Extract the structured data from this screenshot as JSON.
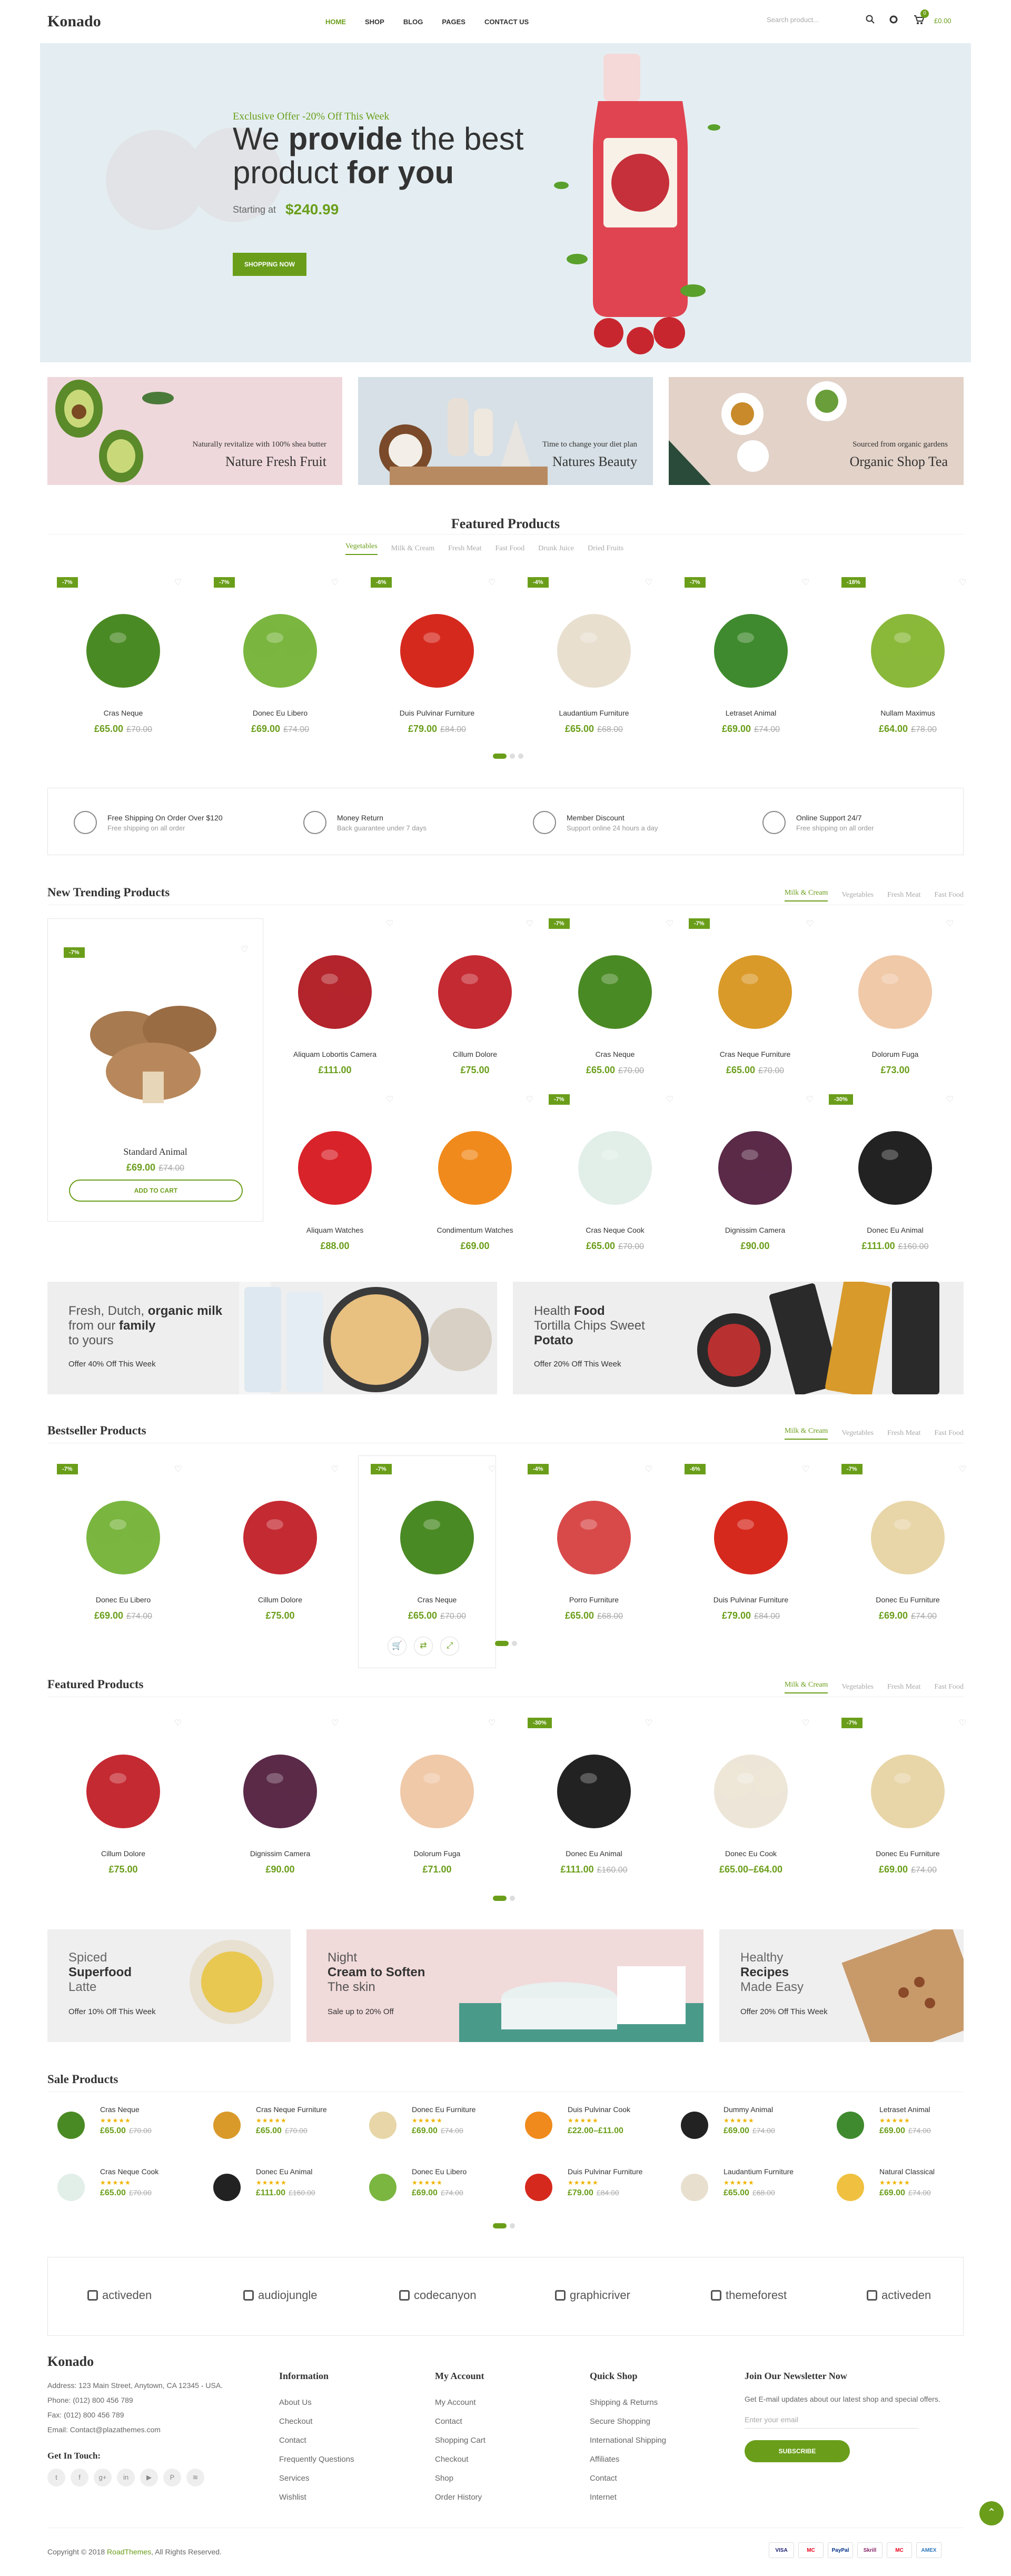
{
  "brand": {
    "logo": "Konado"
  },
  "nav": {
    "home": "HOME",
    "shop": "SHOP",
    "blog": "BLOG",
    "pages": "PAGES",
    "contact": "CONTACT US"
  },
  "header": {
    "search_placeholder": "Search product...",
    "cart_count": "0",
    "cart_total": "£0.00"
  },
  "hero": {
    "eyebrow": "Exclusive Offer -20% Off This Week",
    "line1a": "We ",
    "line1b": "provide",
    "line1c": " the best",
    "line2a": "product ",
    "line2b": "for you",
    "starting": "Starting at",
    "price": "$240.99",
    "button": "SHOPPING NOW"
  },
  "banners": [
    {
      "sub": "Naturally revitalize with 100% shea butter",
      "title": "Nature Fresh Fruit"
    },
    {
      "sub": "Time to change your diet plan",
      "title": "Natures Beauty"
    },
    {
      "sub": "Sourced from organic gardens",
      "title": "Organic Shop Tea"
    }
  ],
  "featured1": {
    "title": "Featured Products",
    "tabs": [
      "Vegetables",
      "Milk & Cream",
      "Fresh Meat",
      "Fast Food",
      "Drunk Juice",
      "Dried Fruits"
    ],
    "items": [
      {
        "badge": "-7%",
        "name": "Cras Neque",
        "price": "£65.00",
        "old": "£70.00",
        "color": "#4a8a24"
      },
      {
        "badge": "-7%",
        "name": "Donec Eu Libero",
        "price": "£69.00",
        "old": "£74.00",
        "color": "#7ab640"
      },
      {
        "badge": "-6%",
        "name": "Duis Pulvinar Furniture",
        "price": "£79.00",
        "old": "£84.00",
        "color": "#d6291e"
      },
      {
        "badge": "-4%",
        "name": "Laudantium Furniture",
        "price": "£65.00",
        "old": "£68.00",
        "color": "#e8dfcf"
      },
      {
        "badge": "-7%",
        "name": "Letraset Animal",
        "price": "£69.00",
        "old": "£74.00",
        "color": "#3f8a2e"
      },
      {
        "badge": "-18%",
        "name": "Nullam Maximus",
        "price": "£64.00",
        "old": "£78.00",
        "color": "#8ab83a"
      }
    ]
  },
  "services": [
    {
      "title": "Free Shipping On Order Over $120",
      "sub": "Free shipping on all order"
    },
    {
      "title": "Money Return",
      "sub": "Back guarantee under 7 days"
    },
    {
      "title": "Member Discount",
      "sub": "Support online 24 hours a day"
    },
    {
      "title": "Online Support 24/7",
      "sub": "Free shipping on all order"
    }
  ],
  "trending": {
    "title": "New Trending Products",
    "tabs": [
      "Milk & Cream",
      "Vegetables",
      "Fresh Meat",
      "Fast Food"
    ],
    "big": {
      "badge": "-7%",
      "name": "Standard Animal",
      "price": "£69.00",
      "old": "£74.00",
      "button": "ADD TO CART"
    },
    "items": [
      {
        "badge": "",
        "name": "Aliquam Lobortis Camera",
        "price": "£111.00",
        "old": "",
        "color": "#b3242c"
      },
      {
        "badge": "",
        "name": "Cillum Dolore",
        "price": "£75.00",
        "old": "",
        "color": "#c42a32"
      },
      {
        "badge": "-7%",
        "name": "Cras Neque",
        "price": "£65.00",
        "old": "£70.00",
        "color": "#4a8a24"
      },
      {
        "badge": "-7%",
        "name": "Cras Neque Furniture",
        "price": "£65.00",
        "old": "£70.00",
        "color": "#d99a2a"
      },
      {
        "badge": "",
        "name": "Dolorum Fuga",
        "price": "£73.00",
        "old": "",
        "color": "#f0c9a8"
      },
      {
        "badge": "",
        "name": "Aliquam Watches",
        "price": "£88.00",
        "old": "",
        "color": "#d8232a"
      },
      {
        "badge": "",
        "name": "Condimentum Watches",
        "price": "£69.00",
        "old": "",
        "color": "#f08a1c"
      },
      {
        "badge": "-7%",
        "name": "Cras Neque Cook",
        "price": "£65.00",
        "old": "£70.00",
        "color": "#e2eee8"
      },
      {
        "badge": "",
        "name": "Dignissim Camera",
        "price": "£90.00",
        "old": "",
        "color": "#5a2a48"
      },
      {
        "badge": "-30%",
        "name": "Donec Eu Animal",
        "price": "£111.00",
        "old": "£160.00",
        "color": "#222"
      }
    ]
  },
  "promos": [
    {
      "l1": "Fresh, Dutch, ",
      "l1b": "organic milk",
      "l2": "from our ",
      "l2b": "family",
      "l3": "to yours",
      "offer": "Offer 40% Off This Week"
    },
    {
      "l1": "Health ",
      "l1b": "Food",
      "l2": "Tortilla Chips Sweet",
      "l2b": "",
      "l3": "Potato",
      "offer": "Offer 20% Off This Week"
    }
  ],
  "bestseller": {
    "title": "Bestseller Products",
    "tabs": [
      "Milk & Cream",
      "Vegetables",
      "Fresh Meat",
      "Fast Food"
    ],
    "items": [
      {
        "badge": "-7%",
        "name": "Donec Eu Libero",
        "price": "£69.00",
        "old": "£74.00",
        "color": "#7ab640"
      },
      {
        "badge": "",
        "name": "Cillum Dolore",
        "price": "£75.00",
        "old": "",
        "color": "#c42a32"
      },
      {
        "badge": "-7%",
        "name": "Cras Neque",
        "price": "£65.00",
        "old": "£70.00",
        "color": "#4a8a24"
      },
      {
        "badge": "-4%",
        "name": "Porro Furniture",
        "price": "£65.00",
        "old": "£68.00",
        "color": "#d84a4a"
      },
      {
        "badge": "-6%",
        "name": "Duis Pulvinar Furniture",
        "price": "£79.00",
        "old": "£84.00",
        "color": "#d6291e"
      },
      {
        "badge": "-7%",
        "name": "Donec Eu Furniture",
        "price": "£69.00",
        "old": "£74.00",
        "color": "#e8d6a8"
      }
    ]
  },
  "featured2": {
    "title": "Featured Products",
    "tabs": [
      "Milk & Cream",
      "Vegetables",
      "Fresh Meat",
      "Fast Food"
    ],
    "items": [
      {
        "badge": "",
        "name": "Cillum Dolore",
        "price": "£75.00",
        "old": "",
        "color": "#c42a32"
      },
      {
        "badge": "",
        "name": "Dignissim Camera",
        "price": "£90.00",
        "old": "",
        "color": "#5a2a48"
      },
      {
        "badge": "",
        "name": "Dolorum Fuga",
        "price": "£71.00",
        "old": "",
        "color": "#f0c9a8"
      },
      {
        "badge": "-30%",
        "name": "Donec Eu Animal",
        "price": "£111.00",
        "old": "£160.00",
        "color": "#222"
      },
      {
        "badge": "",
        "name": "Donec Eu Cook",
        "price": "£65.00–£64.00",
        "old": "",
        "color": "#ede6d8"
      },
      {
        "badge": "-7%",
        "name": "Donec Eu Furniture",
        "price": "£69.00",
        "old": "£74.00",
        "color": "#e8d6a8"
      }
    ]
  },
  "promos2": [
    {
      "l1": "Spiced",
      "l2": "Superfood",
      "l3": "Latte",
      "offer": "Offer 10% Off This Week"
    },
    {
      "l1": "Night",
      "l2": "Cream to Soften",
      "l3": "The skin",
      "offer": "Sale up to 20% Off"
    },
    {
      "l1": "Healthy",
      "l2": "Recipes",
      "l3": "Made Easy",
      "offer": "Offer 20% Off This Week"
    }
  ],
  "sale": {
    "title": "Sale Products",
    "items": [
      {
        "name": "Cras Neque",
        "price": "£65.00",
        "old": "£70.00",
        "color": "#4a8a24"
      },
      {
        "name": "Cras Neque Furniture",
        "price": "£65.00",
        "old": "£70.00",
        "color": "#d99a2a"
      },
      {
        "name": "Donec Eu Furniture",
        "price": "£69.00",
        "old": "£74.00",
        "color": "#e8d6a8"
      },
      {
        "name": "Duis Pulvinar Cook",
        "price": "£22.00–£11.00",
        "old": "",
        "color": "#f08a1c"
      },
      {
        "name": "Dummy Animal",
        "price": "£69.00",
        "old": "£74.00",
        "color": "#222"
      },
      {
        "name": "Letraset Animal",
        "price": "£69.00",
        "old": "£74.00",
        "color": "#3f8a2e"
      },
      {
        "name": "Cras Neque Cook",
        "price": "£65.00",
        "old": "£70.00",
        "color": "#e2eee8"
      },
      {
        "name": "Donec Eu Animal",
        "price": "£111.00",
        "old": "£160.00",
        "color": "#222"
      },
      {
        "name": "Donec Eu Libero",
        "price": "£69.00",
        "old": "£74.00",
        "color": "#7ab640"
      },
      {
        "name": "Duis Pulvinar Furniture",
        "price": "£79.00",
        "old": "£84.00",
        "color": "#d6291e"
      },
      {
        "name": "Laudantium Furniture",
        "price": "£65.00",
        "old": "£68.00",
        "color": "#e8dfcf"
      },
      {
        "name": "Natural Classical",
        "price": "£69.00",
        "old": "£74.00",
        "color": "#f0c040"
      }
    ]
  },
  "brands": [
    "activeden",
    "audiojungle",
    "codecanyon",
    "graphicriver",
    "themeforest",
    "activeden"
  ],
  "footer": {
    "address": "Address: 123 Main Street, Anytown, CA 12345 - USA.",
    "phone": "Phone: (012) 800 456 789",
    "fax": "Fax: (012) 800 456 789",
    "email": "Email: Contact@plazathemes.com",
    "touch": "Get In Touch:",
    "info_title": "Information",
    "info": [
      "About Us",
      "Checkout",
      "Contact",
      "Frequently Questions",
      "Services",
      "Wishlist"
    ],
    "acct_title": "My Account",
    "acct": [
      "My Account",
      "Contact",
      "Shopping Cart",
      "Checkout",
      "Shop",
      "Order History"
    ],
    "quick_title": "Quick Shop",
    "quick": [
      "Shipping & Returns",
      "Secure Shopping",
      "International Shipping",
      "Affiliates",
      "Contact",
      "Internet"
    ],
    "news_title": "Join Our Newsletter Now",
    "news_sub": "Get E-mail updates about our latest shop and special offers.",
    "news_placeholder": "Enter your email",
    "subscribe": "SUBSCRIBE",
    "copyright": "Copyright © 2018 ",
    "copyright_link": "RoadThemes",
    "copyright_end": ", All Rights Reserved.",
    "payments": [
      "VISA",
      "MC",
      "PayPal",
      "Skrill",
      "MC",
      "AMEX"
    ]
  },
  "colors": {
    "accent": "#6a9e1a",
    "hero_bg": "#e4eef2"
  }
}
